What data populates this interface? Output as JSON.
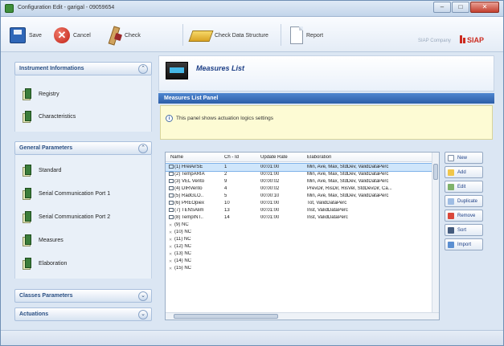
{
  "window": {
    "title": "Configuration Edit - garigal - 09059654",
    "controls": [
      "–",
      "□",
      "✕"
    ]
  },
  "toolbar": {
    "save": "Save",
    "cancel": "Cancel",
    "check": "Check",
    "check_structure": "Check Data Structure",
    "report": "Report",
    "brand_small": "SIAP Company",
    "brand": "SIAP"
  },
  "sidebar": {
    "groups": [
      {
        "label": "Instrument Informations",
        "items": [
          "Registry",
          "Characteristics"
        ]
      },
      {
        "label": "General Parameters",
        "items": [
          "Standard",
          "Serial Communication Port 1",
          "Serial Communication Port 2",
          "Measures",
          "Elaboration"
        ]
      },
      {
        "label": "Classes Parameters",
        "items": []
      },
      {
        "label": "Actuations",
        "items": []
      }
    ]
  },
  "module": {
    "title": "Measures List",
    "panel_title": "Measures List Panel",
    "info_text": "This panel shows actuation logics settings"
  },
  "table": {
    "columns": [
      "Name",
      "Ch - Id",
      "Update Rate",
      "Elaboration"
    ],
    "rows": [
      {
        "name": "(1) HrelAirSE",
        "ch": "1",
        "rate": "00:01:00",
        "elab": "Min, Ave, Max, StdDev, ValidDataPerc"
      },
      {
        "name": "(2) TempARIA",
        "ch": "2",
        "rate": "00:01:00",
        "elab": "Min, Ave, Max, StdDev, ValidDataPerc"
      },
      {
        "name": "(3) VEL Vento",
        "ch": "9",
        "rate": "00:00:02",
        "elab": "Min, Ave, Max, StdDev, ValidDataPerc"
      },
      {
        "name": "(4) DIRVento",
        "ch": "4",
        "rate": "00:00:02",
        "elab": "PrevDir, RisDir, RisVel, StdDevDir, Ca..."
      },
      {
        "name": "(5) RadGLO..",
        "ch": "5",
        "rate": "00:00:10",
        "elab": "Min, Ave, Max, StdDev, ValidDataPerc"
      },
      {
        "name": "(6) PREOpiex",
        "ch": "10",
        "rate": "00:01:00",
        "elab": "Tot, ValidDataPerc"
      },
      {
        "name": "(7) TENSAlim",
        "ch": "13",
        "rate": "00:01:00",
        "elab": "Inst, ValidDataPerc"
      },
      {
        "name": "(8) TempINT..",
        "ch": "14",
        "rate": "00:01:00",
        "elab": "Inst, ValidDataPerc"
      },
      {
        "name": "(9) NC",
        "ch": "",
        "rate": "",
        "elab": ""
      },
      {
        "name": "(10) NC",
        "ch": "",
        "rate": "",
        "elab": ""
      },
      {
        "name": "(11) NC",
        "ch": "",
        "rate": "",
        "elab": ""
      },
      {
        "name": "(12) NC",
        "ch": "",
        "rate": "",
        "elab": ""
      },
      {
        "name": "(13) NC",
        "ch": "",
        "rate": "",
        "elab": ""
      },
      {
        "name": "(14) NC",
        "ch": "",
        "rate": "",
        "elab": ""
      },
      {
        "name": "(15) NC",
        "ch": "",
        "rate": "",
        "elab": ""
      }
    ],
    "selected_index": 0
  },
  "side_buttons": [
    "New",
    "Add",
    "Edit",
    "Duplicate",
    "Remove",
    "Sort",
    "Import"
  ],
  "colors": {
    "accent": "#2c5ea8",
    "selection": "#cfe6fb",
    "info_bg": "#fdfbd4"
  }
}
